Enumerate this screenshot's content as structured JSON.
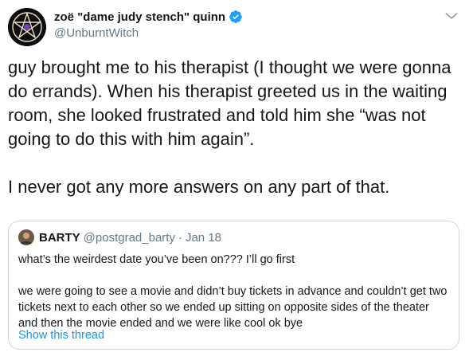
{
  "tweet": {
    "display_name": "zoë \"dame judy stench\" quinn",
    "handle": "@UnburntWitch",
    "text": "guy brought me to his therapist (I thought we were gonna do errands). When his therapist greeted us in the waiting room, she looked frustrated and told him she “was not going to do this with him again”.\n\nI never got any more answers on any part of that."
  },
  "quoted_tweet": {
    "display_name": "BARTY",
    "handle": "@postgrad_barty",
    "separator": "·",
    "date": "Jan 18",
    "text": "what’s the weirdest date you’ve been on??? I’ll go first\n\nwe were going to see a movie and didn’t buy tickets in advance and couldn’t get two tickets next to each other so we ended up sitting on opposite sides of the theater and then the movie ended and we were like cool ok bye",
    "show_thread_label": "Show this thread"
  },
  "icons": {
    "verified": "verified-badge-icon",
    "more": "chevron-down-icon"
  },
  "colors": {
    "link": "#1b95e0",
    "verified": "#1da1f2",
    "secondary_text": "#657786",
    "border": "#ccd6dd"
  }
}
